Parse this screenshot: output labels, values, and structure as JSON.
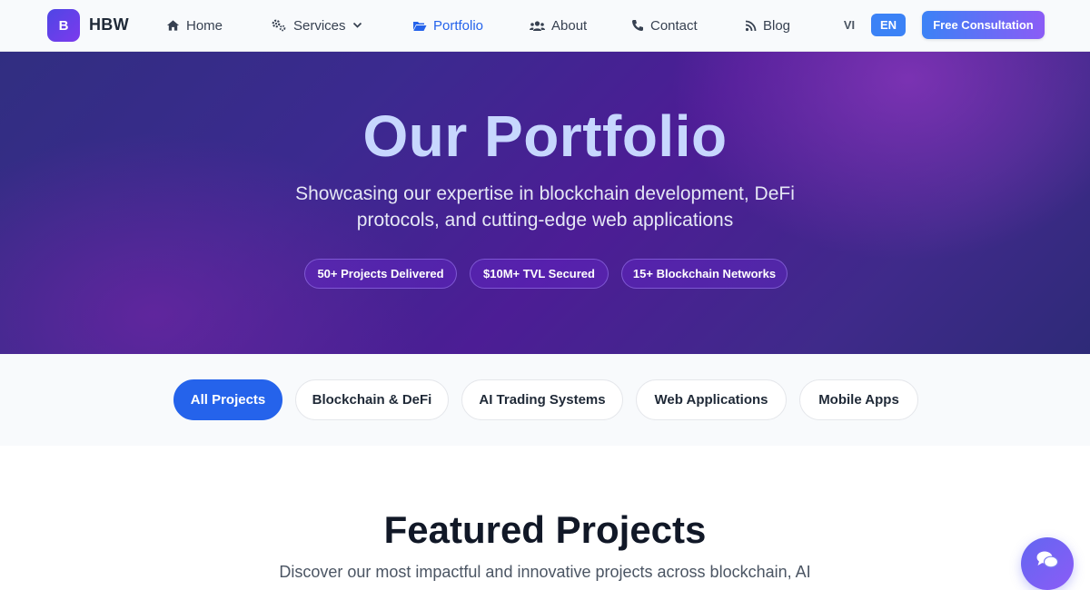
{
  "brand": {
    "badge": "B",
    "name": "HBW"
  },
  "nav": {
    "items": [
      {
        "label": "Home",
        "icon": "home-icon"
      },
      {
        "label": "Services",
        "icon": "gears-icon"
      },
      {
        "label": "Portfolio",
        "icon": "folder-open-icon",
        "active": true
      },
      {
        "label": "About",
        "icon": "users-icon"
      },
      {
        "label": "Contact",
        "icon": "phone-icon"
      },
      {
        "label": "Blog",
        "icon": "rss-icon"
      }
    ],
    "languages": [
      "VI",
      "EN"
    ],
    "selected_language": "EN",
    "cta_label": "Free Consultation"
  },
  "hero": {
    "title": "Our Portfolio",
    "subtitle": "Showcasing our expertise in blockchain development, DeFi protocols, and cutting-edge web applications",
    "stats": [
      "50+ Projects Delivered",
      "$10M+ TVL Secured",
      "15+ Blockchain Networks"
    ]
  },
  "filters": {
    "items": [
      "All Projects",
      "Blockchain & DeFi",
      "AI Trading Systems",
      "Web Applications",
      "Mobile Apps"
    ],
    "active": "All Projects"
  },
  "featured": {
    "title": "Featured Projects",
    "description": "Discover our most impactful and innovative projects across blockchain, AI"
  },
  "colors": {
    "accent": "#2563eb",
    "cta_gradient_start": "#3b82f6",
    "cta_gradient_end": "#8b5cf6",
    "hero_title": "#c7d7fe",
    "hero_bg": "#4c1d95"
  }
}
